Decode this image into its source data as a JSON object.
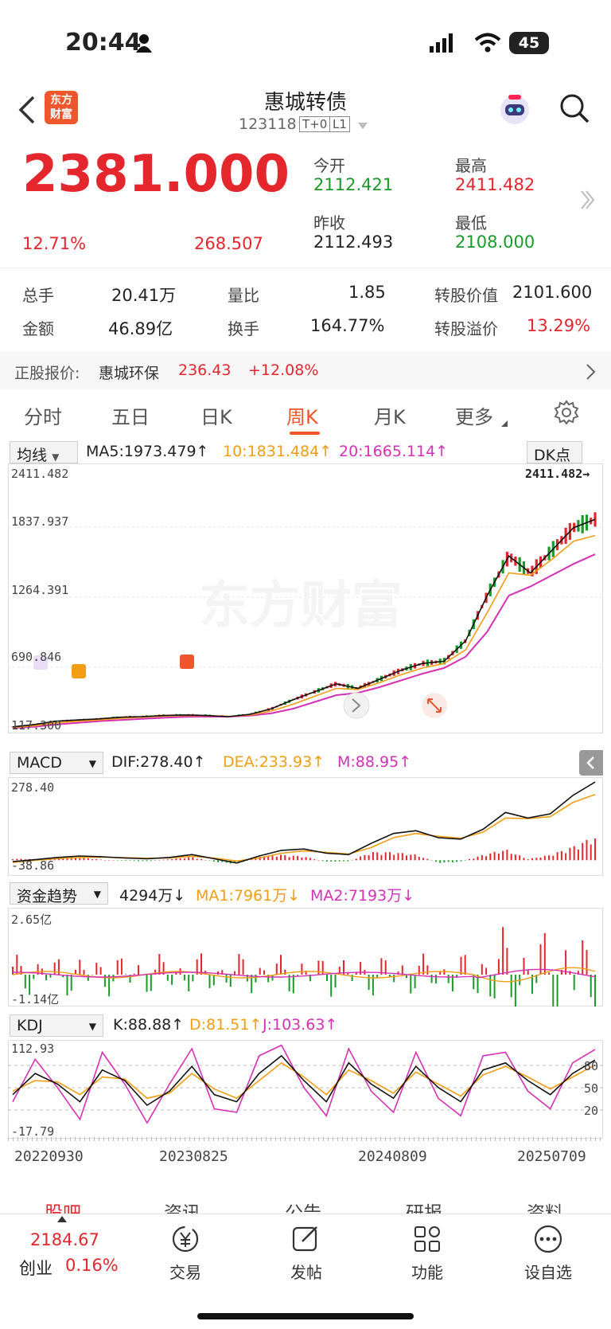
{
  "status": {
    "time": "20:44",
    "battery": "45"
  },
  "header": {
    "title": "惠城转债",
    "code": "123118",
    "badge1": "T+0",
    "badge2": "L1",
    "logo": "东方\n财富"
  },
  "quote": {
    "price": "2381.000",
    "pct": "12.71%",
    "change": "268.507",
    "open_label": "今开",
    "open": "2112.421",
    "high_label": "最高",
    "high": "2411.482",
    "prev_label": "昨收",
    "prev": "2112.493",
    "low_label": "最低",
    "low": "2108.000"
  },
  "stats": [
    {
      "l1": "总手",
      "v1": "20.41万",
      "l2": "量比",
      "v2": "1.85",
      "l3": "转股价值",
      "v3": "2101.600"
    },
    {
      "l1": "金额",
      "v1": "46.89亿",
      "l2": "换手",
      "v2": "164.77%",
      "l3": "转股溢价",
      "v3": "13.29%"
    }
  ],
  "ref": {
    "label": "正股报价:",
    "name": "惠城环保",
    "price": "236.43",
    "pct": "+12.08%"
  },
  "tabs": [
    "分时",
    "五日",
    "日K",
    "周K",
    "月K",
    "更多"
  ],
  "kline": {
    "selector": "均线",
    "ma5": "MA5:1973.479↑",
    "ma10": "10:1831.484↑",
    "ma20": "20:1665.114↑",
    "dk": "DK点",
    "y_labels": [
      "2411.482",
      "1837.937",
      "1264.391",
      "690.846",
      "117.300"
    ],
    "max_label": "2411.482→"
  },
  "macd": {
    "selector": "MACD",
    "dif": "DIF:278.40↑",
    "dea": "DEA:233.93↑",
    "m": "M:88.95↑",
    "top": "278.40",
    "bottom": "-38.86"
  },
  "fund": {
    "selector": "资金趋势",
    "val": "4294万↓",
    "ma1": "MA1:7961万↓",
    "ma2": "MA2:7193万↓",
    "top": "2.65亿",
    "bottom": "-1.14亿"
  },
  "kdj": {
    "selector": "KDJ",
    "k": "K:88.88↑",
    "d": "D:81.51↑",
    "j": "J:103.63↑",
    "top": "112.93",
    "bottom": "-17.79",
    "r80": "80",
    "r50": "50",
    "r20": "20"
  },
  "dates": [
    "20220930",
    "20230825",
    "20240809",
    "20250709"
  ],
  "bottom_tabs": [
    "股吧",
    "资讯",
    "公告",
    "研报",
    "资料"
  ],
  "dock": {
    "index_value": "2184.67",
    "index_name": "创业",
    "index_pct": "0.16%",
    "items": [
      "交易",
      "发帖",
      "功能",
      "设自选"
    ]
  },
  "chart_data": [
    {
      "type": "line",
      "title": "周K",
      "y_range": [
        117.3,
        2411.482
      ],
      "x_dates": [
        "20220930",
        "20230825",
        "20240809",
        "20250709"
      ],
      "series": [
        {
          "name": "MA5",
          "values": [
            140,
            160,
            190,
            200,
            210,
            225,
            230,
            240,
            245,
            240,
            230,
            250,
            300,
            380,
            450,
            520,
            480,
            560,
            640,
            700,
            720,
            900,
            1300,
            1650,
            1500,
            1700,
            1900,
            1973
          ]
        },
        {
          "name": "10",
          "values": [
            135,
            150,
            175,
            190,
            200,
            215,
            225,
            235,
            240,
            238,
            232,
            245,
            280,
            340,
            410,
            480,
            470,
            530,
            600,
            660,
            700,
            820,
            1150,
            1500,
            1480,
            1620,
            1780,
            1831
          ]
        },
        {
          "name": "20",
          "values": [
            130,
            140,
            160,
            175,
            190,
            200,
            210,
            220,
            228,
            230,
            230,
            238,
            260,
            300,
            360,
            420,
            440,
            490,
            550,
            610,
            660,
            760,
            980,
            1300,
            1380,
            1480,
            1580,
            1665
          ]
        }
      ]
    },
    {
      "type": "line",
      "title": "MACD",
      "y_range": [
        -38.86,
        278.4
      ],
      "series": [
        {
          "name": "DIF",
          "values": [
            -5,
            2,
            10,
            15,
            12,
            8,
            5,
            10,
            20,
            5,
            -10,
            15,
            35,
            40,
            25,
            20,
            60,
            95,
            105,
            80,
            75,
            110,
            170,
            150,
            165,
            230,
            278
          ]
        },
        {
          "name": "DEA",
          "values": [
            -8,
            0,
            6,
            10,
            11,
            9,
            7,
            8,
            14,
            8,
            -3,
            8,
            25,
            33,
            28,
            22,
            45,
            80,
            95,
            85,
            78,
            100,
            150,
            148,
            155,
            205,
            234
          ]
        }
      ]
    },
    {
      "type": "line",
      "title": "KDJ",
      "y_range": [
        -17.79,
        112.93
      ],
      "series": [
        {
          "name": "K",
          "values": [
            40,
            70,
            55,
            30,
            75,
            60,
            25,
            45,
            80,
            40,
            30,
            70,
            95,
            60,
            30,
            85,
            55,
            35,
            80,
            50,
            30,
            75,
            85,
            60,
            40,
            70,
            89
          ]
        },
        {
          "name": "D",
          "values": [
            45,
            60,
            58,
            40,
            65,
            62,
            35,
            42,
            70,
            48,
            35,
            60,
            85,
            65,
            40,
            75,
            60,
            42,
            72,
            55,
            38,
            68,
            80,
            65,
            48,
            65,
            82
          ]
        },
        {
          "name": "J",
          "values": [
            30,
            90,
            50,
            5,
            100,
            55,
            0,
            55,
            105,
            20,
            15,
            95,
            110,
            50,
            10,
            105,
            45,
            15,
            100,
            35,
            10,
            95,
            100,
            45,
            20,
            85,
            104
          ]
        }
      ]
    }
  ]
}
